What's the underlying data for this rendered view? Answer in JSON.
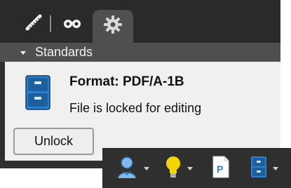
{
  "tabs": [
    {
      "id": "measure",
      "icon": "measure-icon"
    },
    {
      "id": "binoculars",
      "icon": "binoculars-icon"
    },
    {
      "id": "settings",
      "icon": "gear-icon",
      "active": true
    }
  ],
  "section": {
    "title": "Standards",
    "collapsed": false
  },
  "status_block": {
    "title": "Format: PDF/A-1B",
    "message": "File is locked for editing",
    "unlock_label": "Unlock"
  },
  "toolbar": {
    "items": [
      {
        "name": "user",
        "icon": "user-icon",
        "has_dropdown": true
      },
      {
        "name": "hint",
        "icon": "lightbulb-icon",
        "has_dropdown": true
      },
      {
        "name": "pdf",
        "icon": "pdf-page-icon",
        "has_dropdown": false
      },
      {
        "name": "save",
        "icon": "cabinet-icon",
        "has_dropdown": true
      }
    ]
  },
  "colors": {
    "panel_dark": "#2f2f2f",
    "header": "#4f4f4f",
    "content": "#f0f0f0",
    "accent_blue": "#2d7fd0",
    "bulb_yellow": "#f2d600"
  }
}
